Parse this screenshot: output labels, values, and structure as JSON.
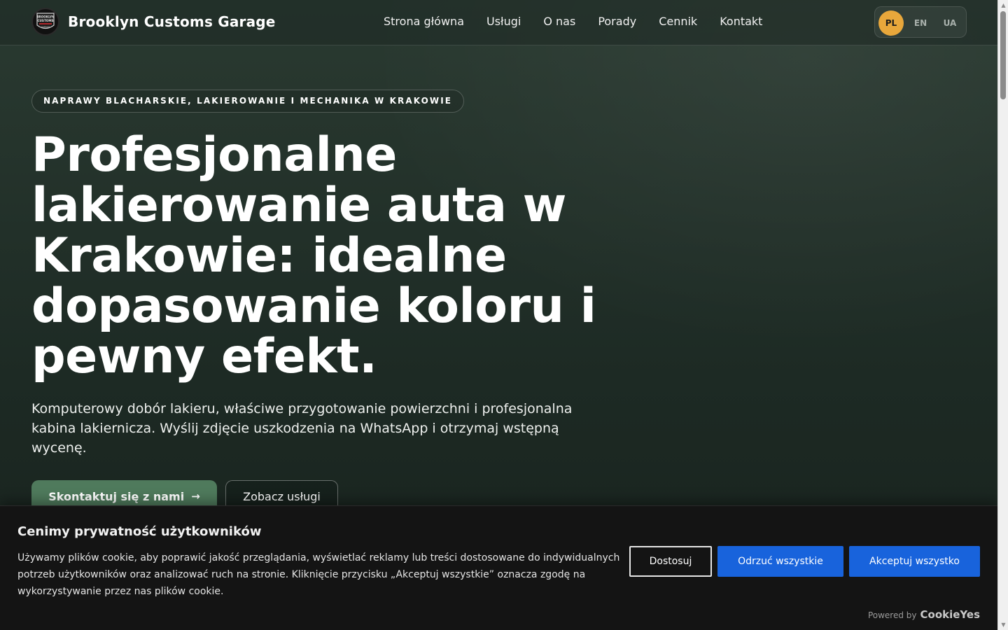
{
  "header": {
    "brand_name": "Brooklyn Customs Garage",
    "logo_text_top": "BROOKLYN",
    "logo_text_mid": "CUSTOMS",
    "logo_text_bottom": "GARAGE",
    "nav": [
      {
        "label": "Strona główna"
      },
      {
        "label": "Usługi"
      },
      {
        "label": "O nas"
      },
      {
        "label": "Porady"
      },
      {
        "label": "Cennik"
      },
      {
        "label": "Kontakt"
      }
    ],
    "languages": [
      {
        "code": "PL",
        "active": true
      },
      {
        "code": "EN",
        "active": false
      },
      {
        "code": "UA",
        "active": false
      }
    ]
  },
  "hero": {
    "tagline": "NAPRAWY BLACHARSKIE, LAKIEROWANIE I MECHANIKA W KRAKOWIE",
    "title": "Profesjonalne lakierowanie auta w Krakowie: idealne dopasowanie koloru i pewny efekt.",
    "subtitle": "Komputerowy dobór lakieru, właściwe przygotowanie powierzchni i profesjonalna kabina lakiernicza. Wyślij zdjęcie uszkodzenia na WhatsApp i otrzymaj wstępną wycenę.",
    "primary_cta": "Skontaktuj się z nami",
    "secondary_cta": "Zobacz usługi"
  },
  "cookie_banner": {
    "title": "Cenimy prywatność użytkowników",
    "text": "Używamy plików cookie, aby poprawić jakość przeglądania, wyświetlać reklamy lub treści dostosowane do indywidualnych potrzeb użytkowników oraz analizować ruch na stronie. Kliknięcie przycisku „Akceptuj wszystkie” oznacza zgodę na wykorzystywanie przez nas plików cookie.",
    "customize_label": "Dostosuj",
    "reject_label": "Odrzuć wszystkie",
    "accept_label": "Akceptuj wszystko",
    "powered_by": "Powered by",
    "powered_brand": "CookieYes"
  },
  "colors": {
    "accent": "#e8a73b",
    "primary_button": "#4f7a5c",
    "cookie_button": "#1863dc",
    "background": "#1d2a24"
  }
}
